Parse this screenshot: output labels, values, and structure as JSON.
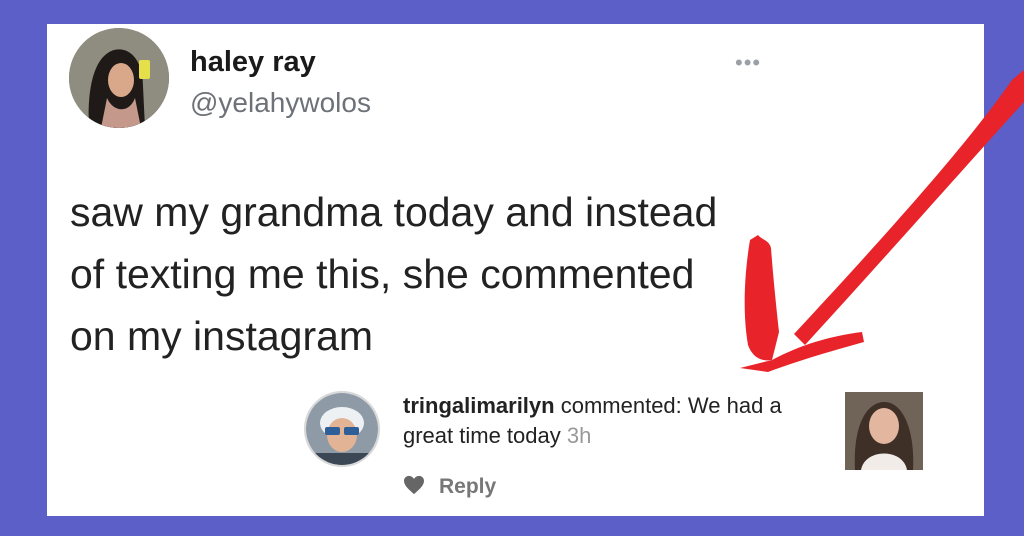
{
  "post": {
    "display_name": "haley ray",
    "handle": "@yelahywolos",
    "more_icon": "more-horizontal-icon",
    "text_lines": [
      "saw my grandma today and instead",
      "of texting me this, she commented",
      "on my instagram"
    ]
  },
  "comment": {
    "username": "tringalimarilyn",
    "action": "commented:",
    "text": "We had a great time today",
    "time": "3h",
    "reply_label": "Reply",
    "like_icon": "heart-icon"
  },
  "colors": {
    "background": "#5b5fc7",
    "card": "#ffffff",
    "arrow": "#e8232a"
  }
}
